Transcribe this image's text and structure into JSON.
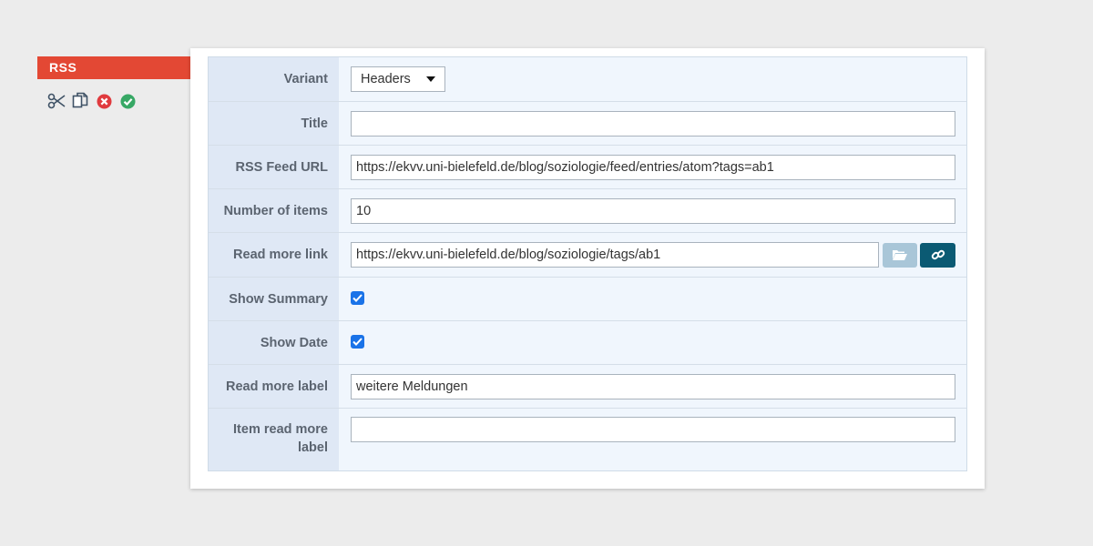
{
  "slice": {
    "label": "RSS",
    "actions": [
      {
        "name": "cut",
        "icon": "scissors-icon"
      },
      {
        "name": "copy",
        "icon": "copy-icon"
      },
      {
        "name": "delete",
        "icon": "close-circle-icon"
      },
      {
        "name": "save",
        "icon": "check-circle-icon"
      }
    ]
  },
  "form": {
    "variant": {
      "label": "Variant",
      "value": "Headers"
    },
    "title": {
      "label": "Title",
      "value": ""
    },
    "feed_url": {
      "label": "RSS Feed URL",
      "value": "https://ekvv.uni-bielefeld.de/blog/soziologie/feed/entries/atom?tags=ab1"
    },
    "num_items": {
      "label": "Number of items",
      "value": "10"
    },
    "read_more_link": {
      "label": "Read more link",
      "value": "https://ekvv.uni-bielefeld.de/blog/soziologie/tags/ab1"
    },
    "show_summary": {
      "label": "Show Summary",
      "checked": true
    },
    "show_date": {
      "label": "Show Date",
      "checked": true
    },
    "read_more_label": {
      "label": "Read more label",
      "value": "weitere Meldungen"
    },
    "item_read_more_label": {
      "label_line1": "Item read more",
      "label_line2": "label",
      "value": ""
    }
  },
  "colors": {
    "slice_tag": "#e34834",
    "label_bg": "#dfe8f5",
    "field_bg": "#f0f6fd",
    "link_button": "#0b5a73",
    "browse_button": "#a9c6d8",
    "checkbox": "#1a73e8"
  }
}
